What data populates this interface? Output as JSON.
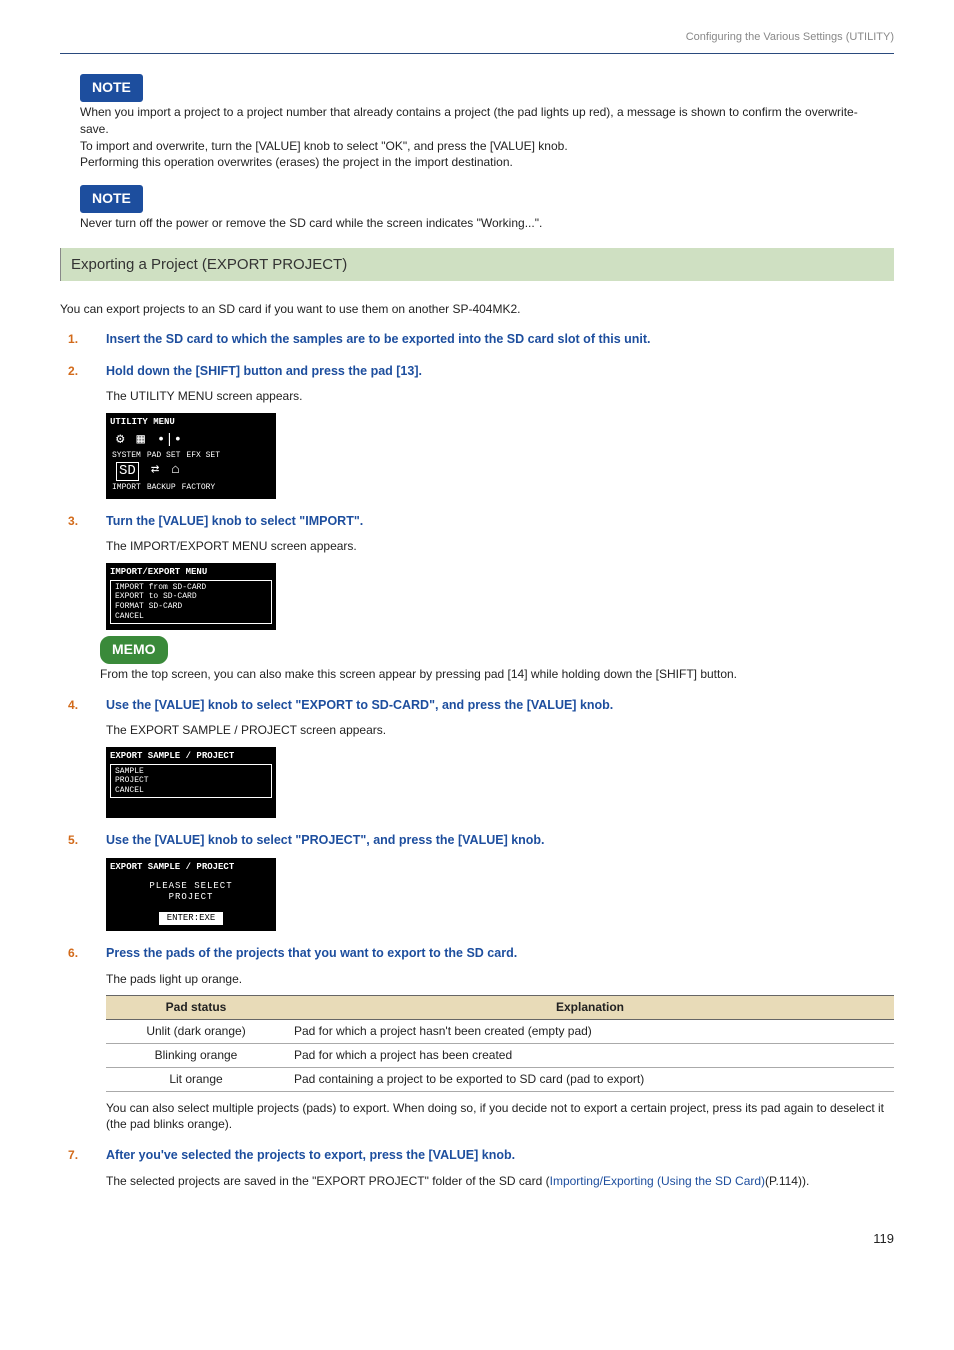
{
  "breadcrumb": "Configuring the Various Settings (UTILITY)",
  "badges": {
    "note": "NOTE",
    "memo": "MEMO"
  },
  "note1": {
    "p1": "When you import a project to a project number that already contains a project (the pad lights up red), a message is shown to confirm the overwrite-save.",
    "p2": "To import and overwrite, turn the [VALUE] knob to select \"OK\", and press the [VALUE] knob.",
    "p3": "Performing this operation overwrites (erases) the project in the import destination."
  },
  "note2": {
    "p1": "Never turn off the power or remove the SD card while the screen indicates \"Working...\"."
  },
  "section_title": "Exporting a Project (EXPORT PROJECT)",
  "intro": "You can export projects to an SD card if you want to use them on another SP-404MK2.",
  "steps": {
    "s1": {
      "title": "Insert the SD card to which the samples are to be exported into the SD card slot of this unit."
    },
    "s2": {
      "title": "Hold down the [SHIFT] button and press the pad [13].",
      "body": "The UTILITY MENU screen appears.",
      "screen": {
        "title": "UTILITY MENU",
        "row1_labels": [
          "SYSTEM",
          "PAD SET",
          "EFX SET"
        ],
        "row2_labels": [
          "IMPORT",
          "BACKUP",
          "FACTORY"
        ]
      }
    },
    "s3": {
      "title": "Turn the [VALUE] knob to select \"IMPORT\".",
      "body": "The IMPORT/EXPORT MENU screen appears.",
      "screen": {
        "title": "IMPORT/EXPORT MENU",
        "items": [
          "IMPORT from SD-CARD",
          "EXPORT to SD-CARD",
          "FORMAT SD-CARD",
          "CANCEL"
        ]
      },
      "memo": "From the top screen, you can also make this screen appear by pressing pad [14] while holding down the [SHIFT] button."
    },
    "s4": {
      "title": "Use the [VALUE] knob to select \"EXPORT to SD-CARD\", and press the [VALUE] knob.",
      "body": "The EXPORT SAMPLE / PROJECT screen appears.",
      "screen": {
        "title": "EXPORT SAMPLE / PROJECT",
        "items": [
          "SAMPLE",
          "PROJECT",
          "CANCEL"
        ]
      }
    },
    "s5": {
      "title": "Use the [VALUE] knob to select \"PROJECT\", and press the [VALUE] knob.",
      "screen": {
        "title": "EXPORT SAMPLE / PROJECT",
        "line1": "PLEASE SELECT",
        "line2": "PROJECT",
        "line3": "ENTER:EXE"
      }
    },
    "s6": {
      "title": "Press the pads of the projects that you want to export to the SD card.",
      "body": "The pads light up orange.",
      "table": {
        "headers": [
          "Pad status",
          "Explanation"
        ],
        "rows": [
          [
            "Unlit (dark orange)",
            "Pad for which a project hasn't been created (empty pad)"
          ],
          [
            "Blinking orange",
            "Pad for which a project has been created"
          ],
          [
            "Lit orange",
            "Pad containing a project to be exported to SD card (pad to export)"
          ]
        ]
      },
      "after": "You can also select multiple projects (pads) to export. When doing so, if you decide not to export a certain project, press its pad again to deselect it (the pad blinks orange)."
    },
    "s7": {
      "title": "After you've selected the projects to export, press the [VALUE] knob.",
      "body_pre": "The selected projects are saved in the \"EXPORT PROJECT\" folder of the SD card (",
      "link": "Importing/Exporting (Using the SD Card)",
      "body_post": "(P.114))."
    }
  },
  "page_number": "119"
}
